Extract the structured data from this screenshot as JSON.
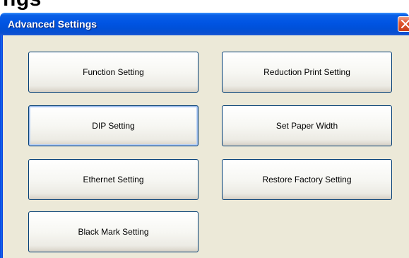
{
  "background_heading": "ngs",
  "window": {
    "title": "Advanced Settings",
    "close_icon": "close-icon"
  },
  "buttons": {
    "function_setting": "Function Setting",
    "reduction_print_setting": "Reduction Print Setting",
    "dip_setting": "DIP Setting",
    "set_paper_width": "Set Paper Width",
    "ethernet_setting": "Ethernet Setting",
    "restore_factory_setting": "Restore Factory Setting",
    "black_mark_setting": "Black Mark Setting"
  },
  "colors": {
    "titlebar": "#0054e3",
    "client_bg": "#ece9d8",
    "button_border": "#003c74",
    "close_button": "#e0562e"
  }
}
